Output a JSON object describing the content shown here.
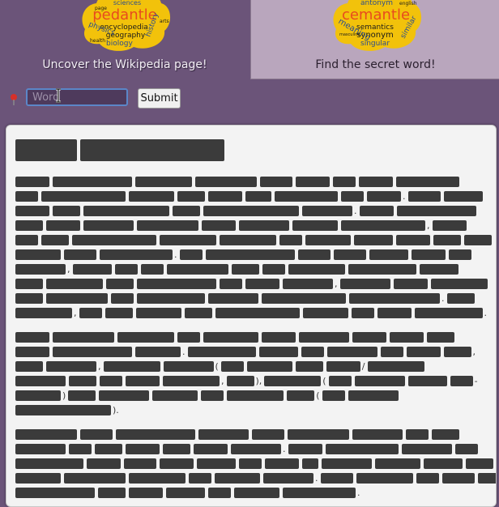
{
  "tabs": [
    {
      "name": "pedantle",
      "caption": "Uncover the Wikipedia page!",
      "logo_words": [
        "pedantle",
        "sciences",
        "encyclopedia",
        "geography",
        "physics",
        "history",
        "biology",
        "page",
        "health",
        "arts"
      ],
      "logo_color": "#f2c20b",
      "logo_word_color": "#e84b1e",
      "active": true
    },
    {
      "name": "cemantle",
      "caption": "Find the secret word!",
      "logo_words": [
        "cemantle",
        "antonym",
        "semantics",
        "synonym",
        "meaning",
        "similar",
        "singular",
        "english",
        "masculine"
      ],
      "logo_color": "#f2c20b",
      "logo_word_color": "#e84b1e",
      "active": false
    }
  ],
  "guess": {
    "pin_icon": "pin-icon",
    "placeholder": "Word",
    "value": "",
    "submit_label": "Submit"
  },
  "colors": {
    "background": "#6b5479",
    "panel": "#f3f3f3",
    "hidden_word": "#3b3b3b",
    "input_border": "#5b86c8"
  },
  "article": {
    "hidden_title_words": 2,
    "paragraphs": [
      {
        "hidden_lines": 10
      },
      {
        "hidden_lines": 6
      },
      {
        "hidden_lines": 5
      }
    ]
  }
}
